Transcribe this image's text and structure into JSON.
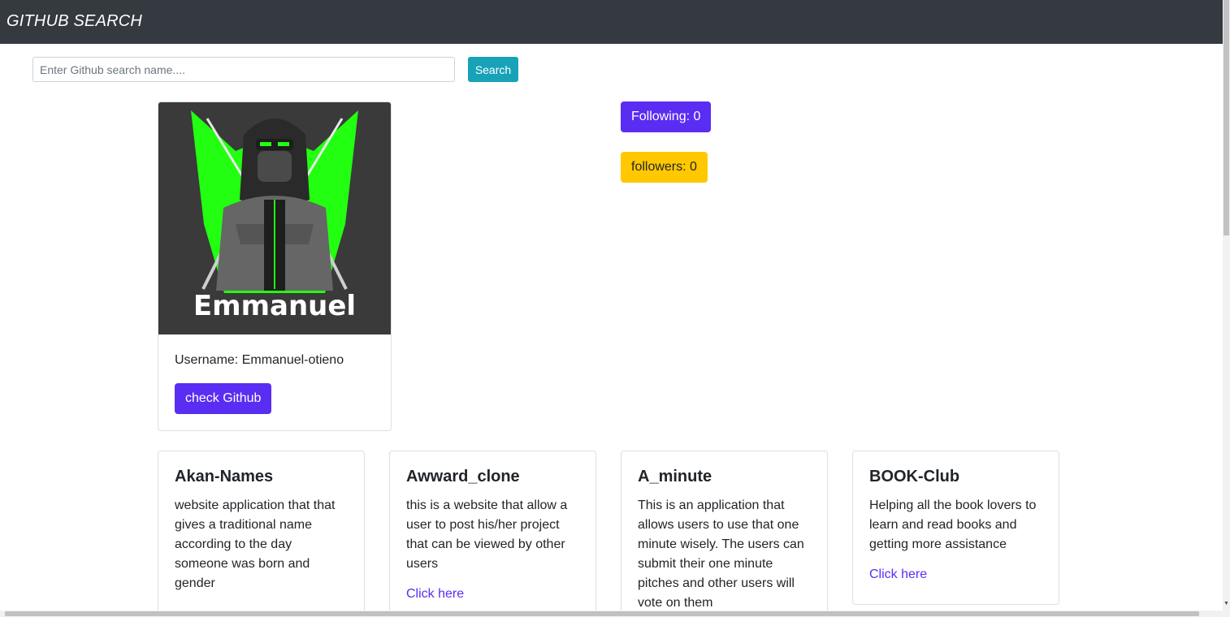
{
  "navbar": {
    "brand": "GITHUB SEARCH"
  },
  "search": {
    "placeholder": "Enter Github search name....",
    "button_label": "Search"
  },
  "profile": {
    "avatar_caption": "Emmanuel",
    "username_text": "Username: Emmanuel-otieno",
    "check_button_label": "check Github",
    "following_label": "Following: 0",
    "followers_label": "followers: 0"
  },
  "repos": [
    {
      "title": "Akan-Names",
      "description": "website application that that gives a traditional name according to the day someone was born and gender",
      "link_label": ""
    },
    {
      "title": "Awward_clone",
      "description": "this is a website that allow a user to post his/her project that can be viewed by other users",
      "link_label": "Click here"
    },
    {
      "title": "A_minute",
      "description": "This is an application that allows users to use that one minute wisely. The users can submit their one minute pitches and other users will vote on them",
      "link_label": ""
    },
    {
      "title": "BOOK-Club",
      "description": "Helping all the book lovers to learn and read books and getting more assistance",
      "link_label": "Click here"
    }
  ],
  "colors": {
    "navbar": "#343a40",
    "accent": "#5a2df2",
    "warning": "#ffc800",
    "info": "#17a2b8"
  }
}
